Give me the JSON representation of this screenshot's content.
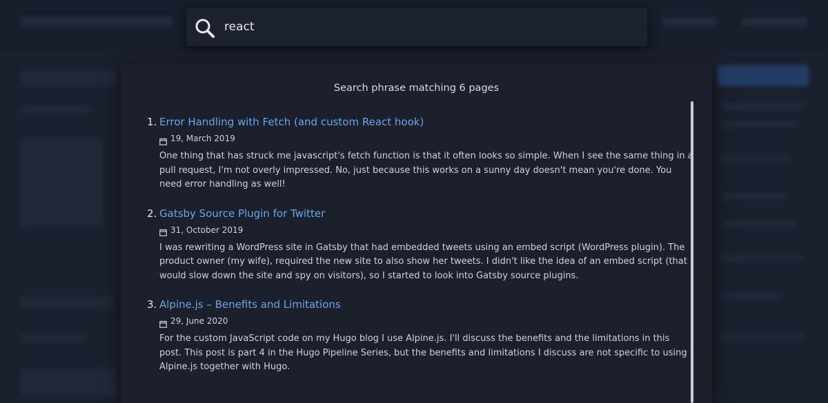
{
  "search": {
    "query": "react"
  },
  "results_header": "Search phrase matching 6 pages",
  "results": [
    {
      "number": "1.",
      "title": "Error Handling with Fetch (and custom React hook)",
      "date": "19, March 2019",
      "excerpt": "One thing that has struck me javascript's fetch function is that it often looks so simple. When I see the same thing in a pull request, I'm not overly impressed. No, just because this works on a sunny day doesn't mean you're done. You need error handling as well!"
    },
    {
      "number": "2.",
      "title": "Gatsby Source Plugin for Twitter",
      "date": "31, October 2019",
      "excerpt": "I was rewriting a WordPress site in Gatsby that had embedded tweets using an embed script (WordPress plugin). The product owner (my wife), required the new site to also show her tweets. I didn't like the idea of an embed script (that would slow down the site and spy on visitors), so I started to look into Gatsby source plugins."
    },
    {
      "number": "3.",
      "title": "Alpine.js – Benefits and Limitations",
      "date": "29, June 2020",
      "excerpt": "For the custom JavaScript code on my Hugo blog I use Alpine.js. I'll discuss the benefits and the limitations in this post. This post is part 4 in the Hugo Pipeline Series, but the benefits and limitations I discuss are not specific to using Alpine.js together with Hugo."
    }
  ],
  "icons": {
    "search": "search-icon",
    "calendar": "calendar-icon"
  },
  "colors": {
    "link": "#6aa6e6",
    "panel_bg": "#1b202c",
    "text": "#cfd3d9"
  }
}
